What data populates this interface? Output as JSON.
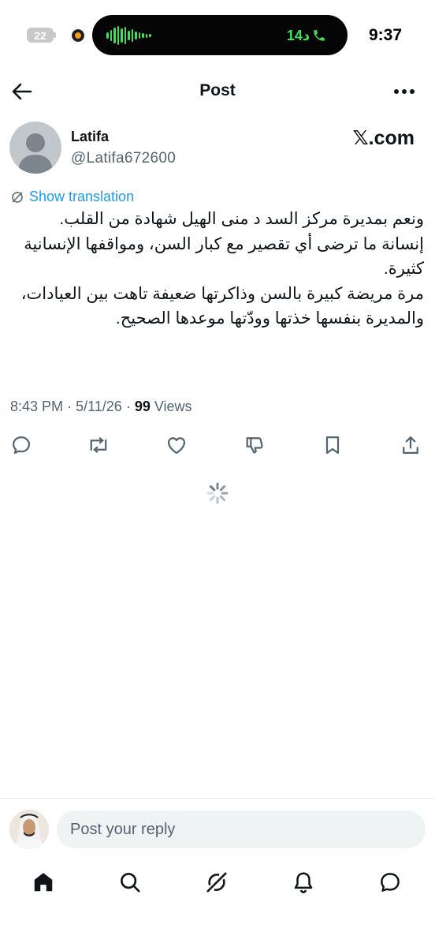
{
  "status_bar": {
    "battery_level": "22",
    "call_duration": "14د",
    "time": "9:37"
  },
  "header": {
    "title": "Post"
  },
  "author": {
    "name": "Latifa",
    "handle": "@Latifa672600",
    "brand": "𝕏.com"
  },
  "post": {
    "translate_label": "Show translation",
    "text": "ونعم بمديرة مركز السد د منى الهيل شهادة من القلب.\nإنسانة ما ترضى أي تقصير مع كبار السن، ومواقفها الإنسانية كثيرة.\nمرة مريضة كبيرة بالسن وذاكرتها ضعيفة تاهت بين العيادات، والمديرة بنفسها خذتها وودّتها موعدها الصحيح.",
    "time": "8:43 PM",
    "date": "5/11/26",
    "views_count": "99",
    "views_label": "Views"
  },
  "actions": [
    "reply-icon",
    "repost-icon",
    "like-icon",
    "dislike-icon",
    "bookmark-icon",
    "share-icon"
  ],
  "reply": {
    "placeholder": "Post your reply"
  },
  "tabbar": [
    "home-icon",
    "search-icon",
    "grok-icon",
    "notifications-icon",
    "messages-icon"
  ],
  "colors": {
    "accent": "#1d9bf0",
    "call_green": "#3ee05a",
    "secondary_text": "#536471"
  }
}
